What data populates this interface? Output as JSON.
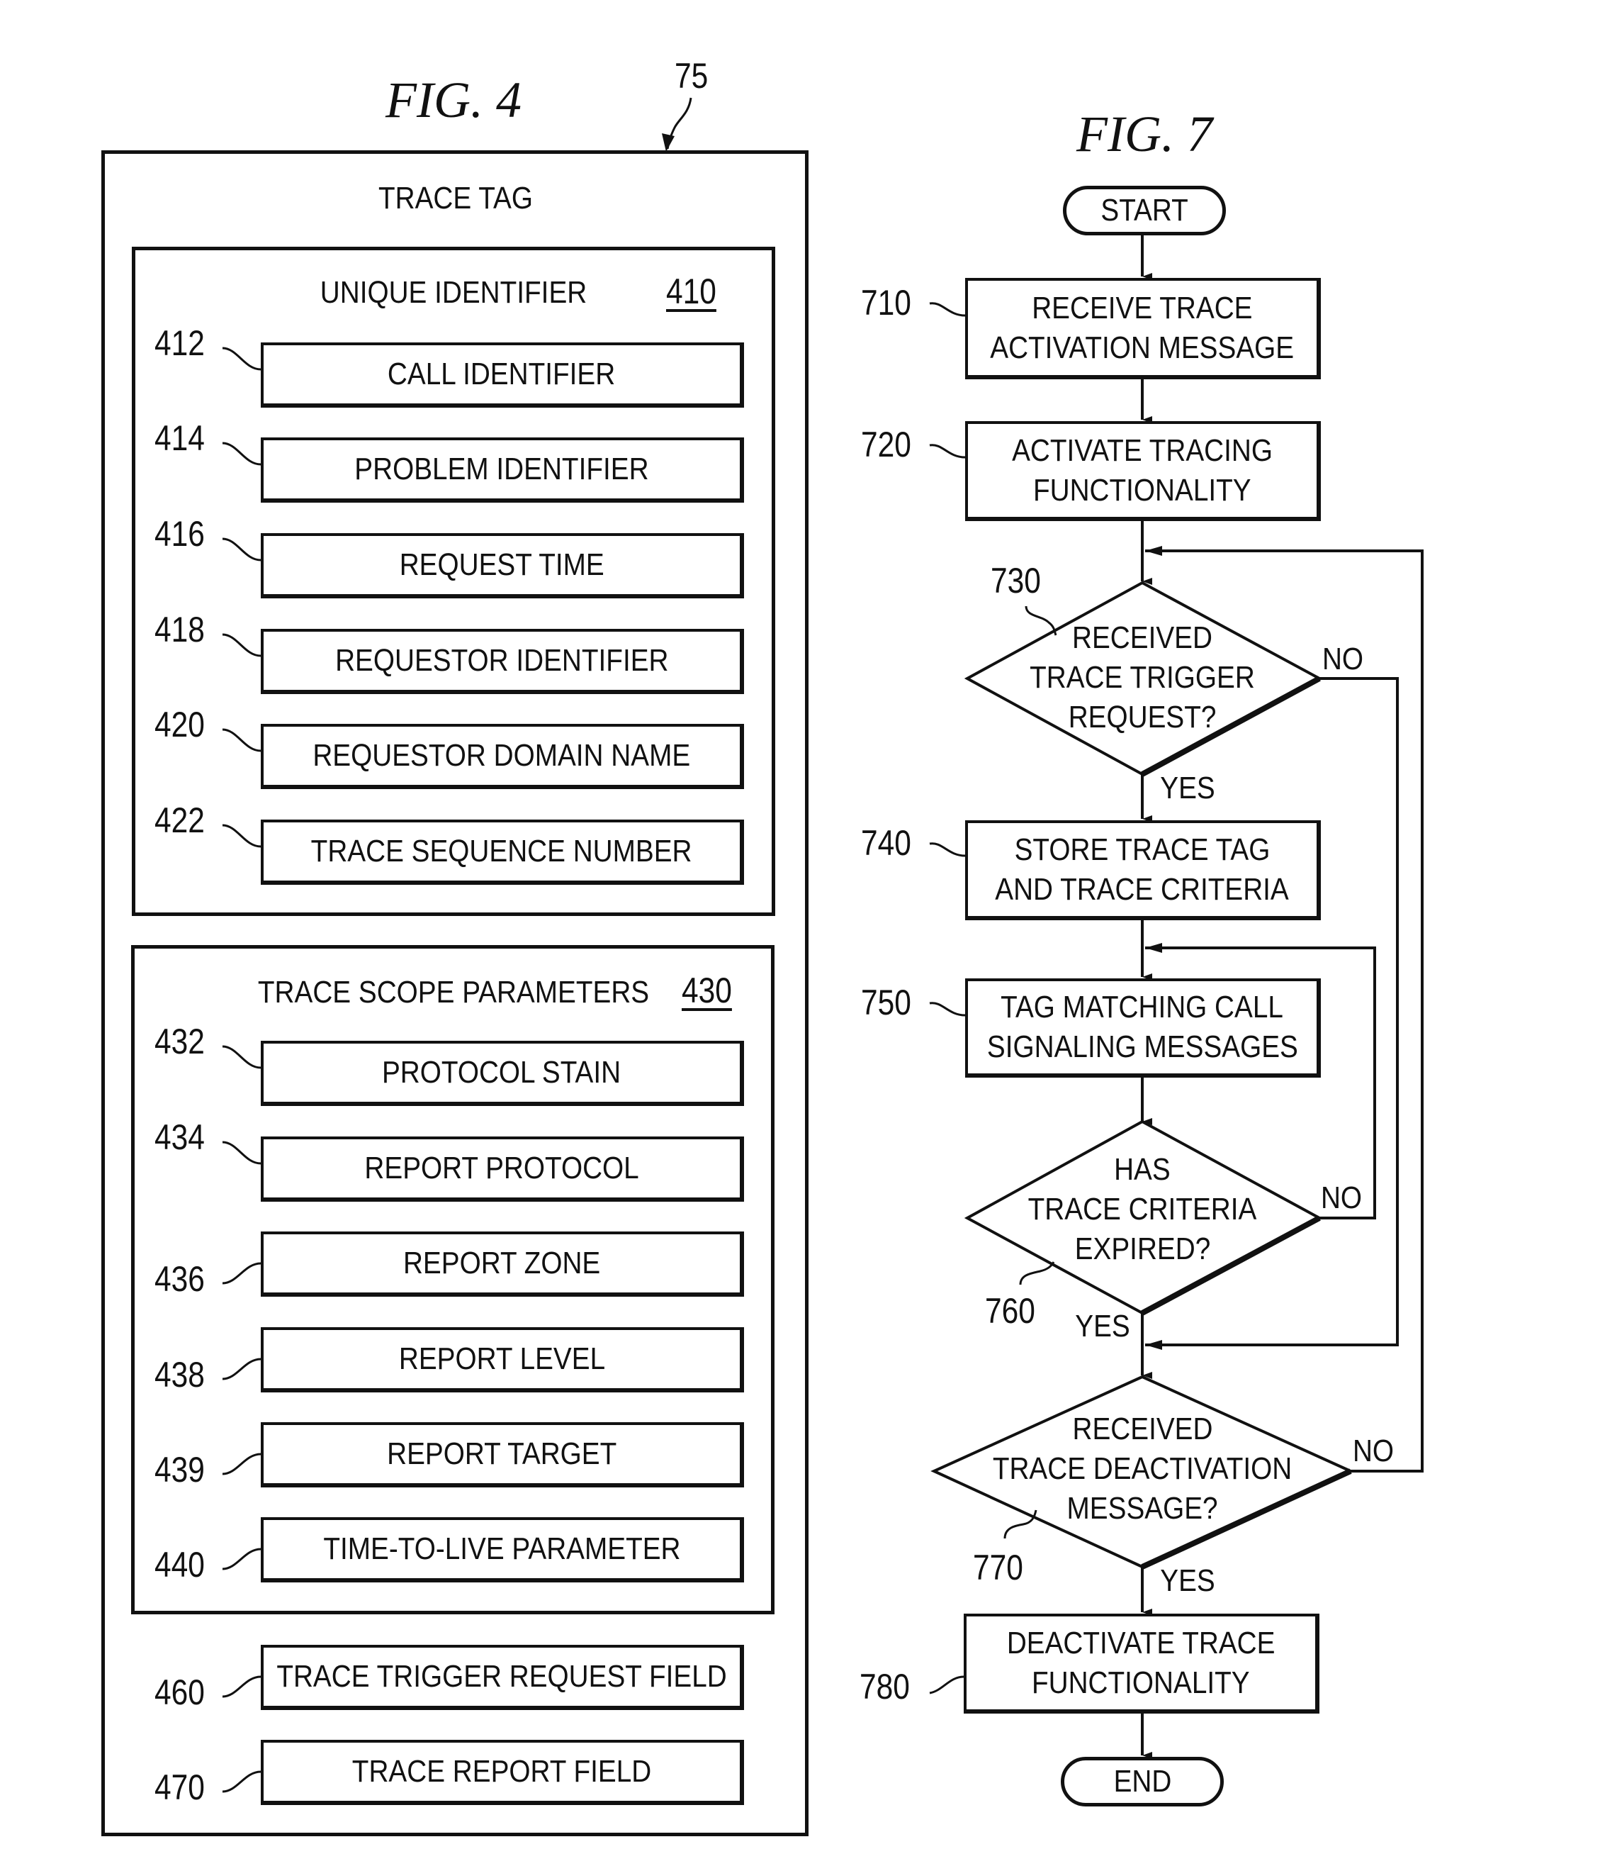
{
  "fig4": {
    "title": "FIG. 4",
    "ref": "75",
    "container_label": "TRACE TAG",
    "unique_identifier": {
      "title": "UNIQUE IDENTIFIER",
      "ref": "410",
      "items": [
        {
          "ref": "412",
          "label": "CALL IDENTIFIER"
        },
        {
          "ref": "414",
          "label": "PROBLEM IDENTIFIER"
        },
        {
          "ref": "416",
          "label": "REQUEST TIME"
        },
        {
          "ref": "418",
          "label": "REQUESTOR IDENTIFIER"
        },
        {
          "ref": "420",
          "label": "REQUESTOR DOMAIN NAME"
        },
        {
          "ref": "422",
          "label": "TRACE SEQUENCE NUMBER"
        }
      ]
    },
    "trace_scope": {
      "title": "TRACE SCOPE PARAMETERS",
      "ref": "430",
      "items": [
        {
          "ref": "432",
          "label": "PROTOCOL STAIN"
        },
        {
          "ref": "434",
          "label": "REPORT PROTOCOL"
        },
        {
          "ref": "436",
          "label": "REPORT ZONE"
        },
        {
          "ref": "438",
          "label": "REPORT LEVEL"
        },
        {
          "ref": "439",
          "label": "REPORT TARGET"
        },
        {
          "ref": "440",
          "label": "TIME-TO-LIVE PARAMETER"
        }
      ]
    },
    "fields": [
      {
        "ref": "460",
        "label": "TRACE TRIGGER REQUEST FIELD"
      },
      {
        "ref": "470",
        "label": "TRACE REPORT FIELD"
      }
    ]
  },
  "fig7": {
    "title": "FIG. 7",
    "start": "START",
    "end": "END",
    "steps": {
      "s710": {
        "ref": "710",
        "lines": [
          "RECEIVE TRACE",
          "ACTIVATION MESSAGE"
        ]
      },
      "s720": {
        "ref": "720",
        "lines": [
          "ACTIVATE TRACING",
          "FUNCTIONALITY"
        ]
      },
      "d730": {
        "ref": "730",
        "lines": [
          "RECEIVED",
          "TRACE TRIGGER",
          "REQUEST?"
        ],
        "yes": "YES",
        "no": "NO"
      },
      "s740": {
        "ref": "740",
        "lines": [
          "STORE TRACE TAG",
          "AND TRACE CRITERIA"
        ]
      },
      "s750": {
        "ref": "750",
        "lines": [
          "TAG MATCHING CALL",
          "SIGNALING MESSAGES"
        ]
      },
      "d760": {
        "ref": "760",
        "lines": [
          "HAS",
          "TRACE CRITERIA",
          "EXPIRED?"
        ],
        "yes": "YES",
        "no": "NO"
      },
      "d770": {
        "ref": "770",
        "lines": [
          "RECEIVED",
          "TRACE DEACTIVATION",
          "MESSAGE?"
        ],
        "yes": "YES",
        "no": "NO"
      },
      "s780": {
        "ref": "780",
        "lines": [
          "DEACTIVATE TRACE",
          "FUNCTIONALITY"
        ]
      }
    }
  }
}
